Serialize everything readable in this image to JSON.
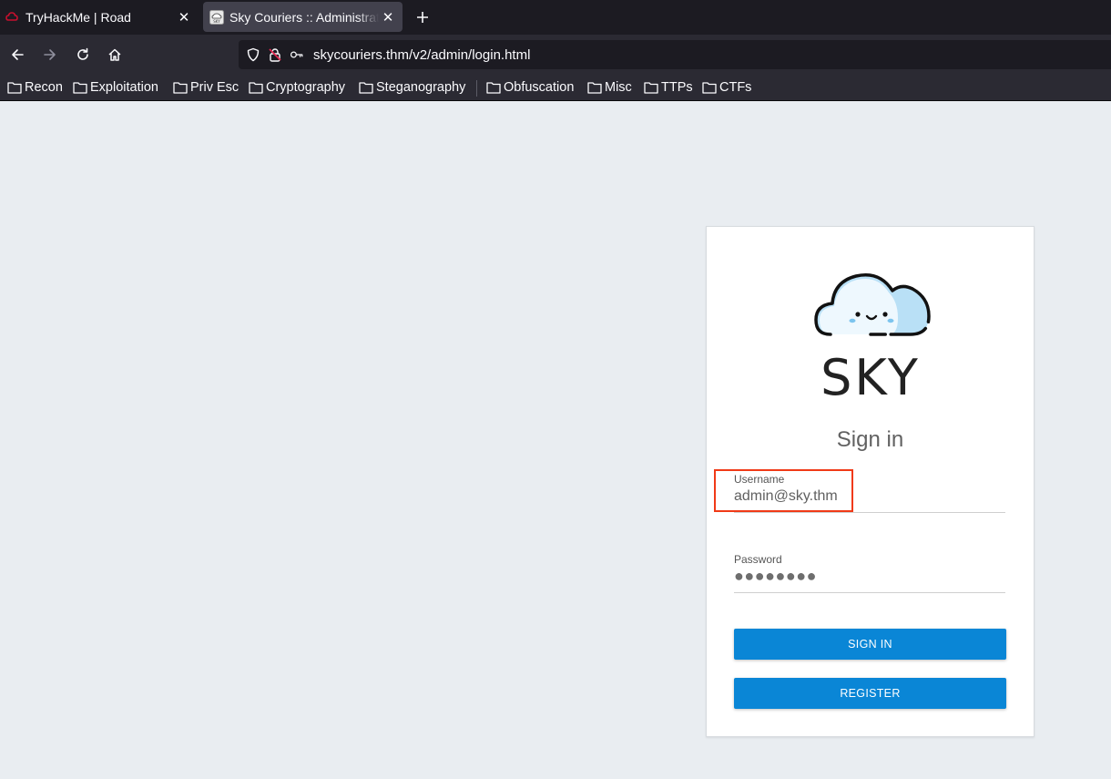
{
  "browser": {
    "tabs": [
      {
        "title": "TryHackMe | Road",
        "active": false
      },
      {
        "title": "Sky Couriers :: Administrator",
        "active": true
      }
    ],
    "url": "skycouriers.thm/v2/admin/login.html",
    "bookmarks": [
      "Recon",
      "Exploitation",
      "Priv Esc",
      "Cryptography",
      "Steganography",
      "Obfuscation",
      "Misc",
      "TTPs",
      "CTFs"
    ]
  },
  "login": {
    "logo_text": "SKY",
    "title": "Sign in",
    "username_label": "Username",
    "username_value": "admin@sky.thm",
    "password_label": "Password",
    "password_mask": "●●●●●●●●",
    "signin_button": "SIGN IN",
    "register_button": "REGISTER"
  },
  "colors": {
    "accent": "#0a86d6",
    "highlight": "#f03a17",
    "page_bg": "#e9edf1",
    "tabbar_bg": "#1c1b22",
    "toolbar_bg": "#2b2a33"
  }
}
